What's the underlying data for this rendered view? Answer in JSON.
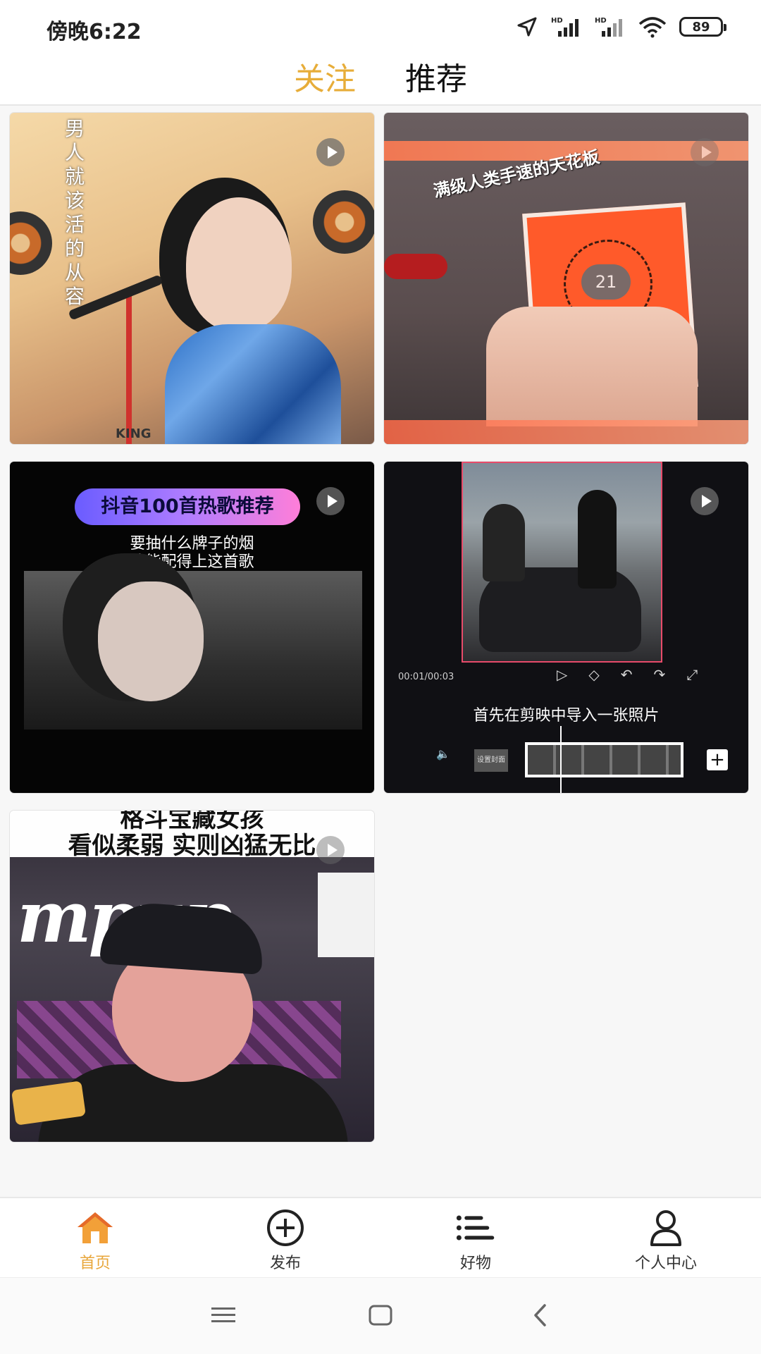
{
  "status_bar": {
    "time": "傍晚6:22",
    "battery": "89",
    "icons": [
      "location-icon",
      "signal-hd-1-icon",
      "signal-hd-2-icon",
      "wifi-icon",
      "battery-icon"
    ],
    "hd_label": "HD"
  },
  "top_tabs": [
    {
      "label": "关注",
      "active": true
    },
    {
      "label": "推荐",
      "active": false
    }
  ],
  "feed": {
    "cards": [
      {
        "poem": "男人就该活的从容",
        "sign": "KING"
      },
      {
        "caption": "满级人类手速的天花板",
        "number": "21"
      },
      {
        "pill": "抖音100首热歌推荐",
        "line1": "要抽什么牌子的烟",
        "line2": "才能配得上这首歌"
      },
      {
        "time": "00:01/00:03",
        "caption": "首先在剪映中导入一张照片",
        "cover_label": "设置封面",
        "add": "+"
      },
      {
        "title_line1": "格斗宝藏女孩",
        "title_line2": "看似柔弱 实则凶猛无比",
        "brand": "mpup"
      }
    ]
  },
  "bottom_nav": [
    {
      "label": "首页",
      "icon": "home-icon",
      "active": true
    },
    {
      "label": "发布",
      "icon": "plus-circle-icon",
      "active": false
    },
    {
      "label": "好物",
      "icon": "list-icon",
      "active": false
    },
    {
      "label": "个人中心",
      "icon": "user-icon",
      "active": false
    }
  ],
  "colors": {
    "accent": "#e8a63a",
    "tab_active": "#e7ad39"
  }
}
